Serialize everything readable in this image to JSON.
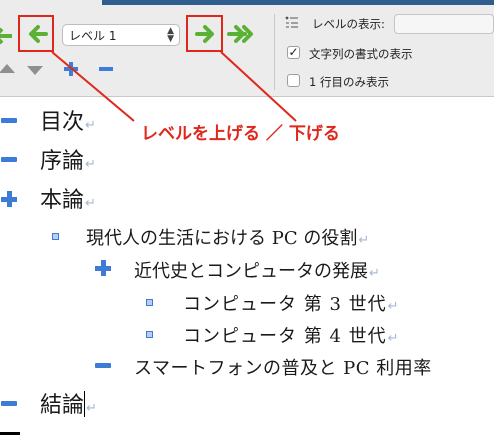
{
  "toolbar": {
    "level_select": {
      "value": "レベル 1"
    },
    "show_level_label": "レベルの表示:",
    "show_formatting_label": "文字列の書式の表示",
    "show_formatting_checked": true,
    "first_line_only_label": "1 行目のみ表示",
    "first_line_only_checked": false,
    "checkmark": "✓",
    "select_chevrons": "▲▼"
  },
  "annotation": {
    "text": "レベルを上げる ／ 下げる",
    "color": "#e0271b"
  },
  "outline": {
    "paragraph_mark": "↵",
    "items": [
      {
        "text": "目次",
        "symbol": "minus"
      },
      {
        "text": "序論",
        "symbol": "minus"
      },
      {
        "text": "本論",
        "symbol": "plus"
      },
      {
        "text": "現代人の生活における PC の役割",
        "symbol": "dot"
      },
      {
        "text": "近代史とコンピュータの発展",
        "symbol": "plus"
      },
      {
        "text": "コンピュータ 第 3 世代",
        "symbol": "dot"
      },
      {
        "text": "コンピュータ 第 4 世代",
        "symbol": "dot"
      },
      {
        "text": "スマートフォンの普及と PC 利用率",
        "symbol": "minus"
      },
      {
        "text": "結論",
        "symbol": "minus"
      }
    ]
  },
  "colors": {
    "outline_symbol": "#3d7bd6",
    "arrow_green": "#5bb135",
    "highlight_red": "#e0271b",
    "paragraph_mark": "#a7b7cf"
  }
}
